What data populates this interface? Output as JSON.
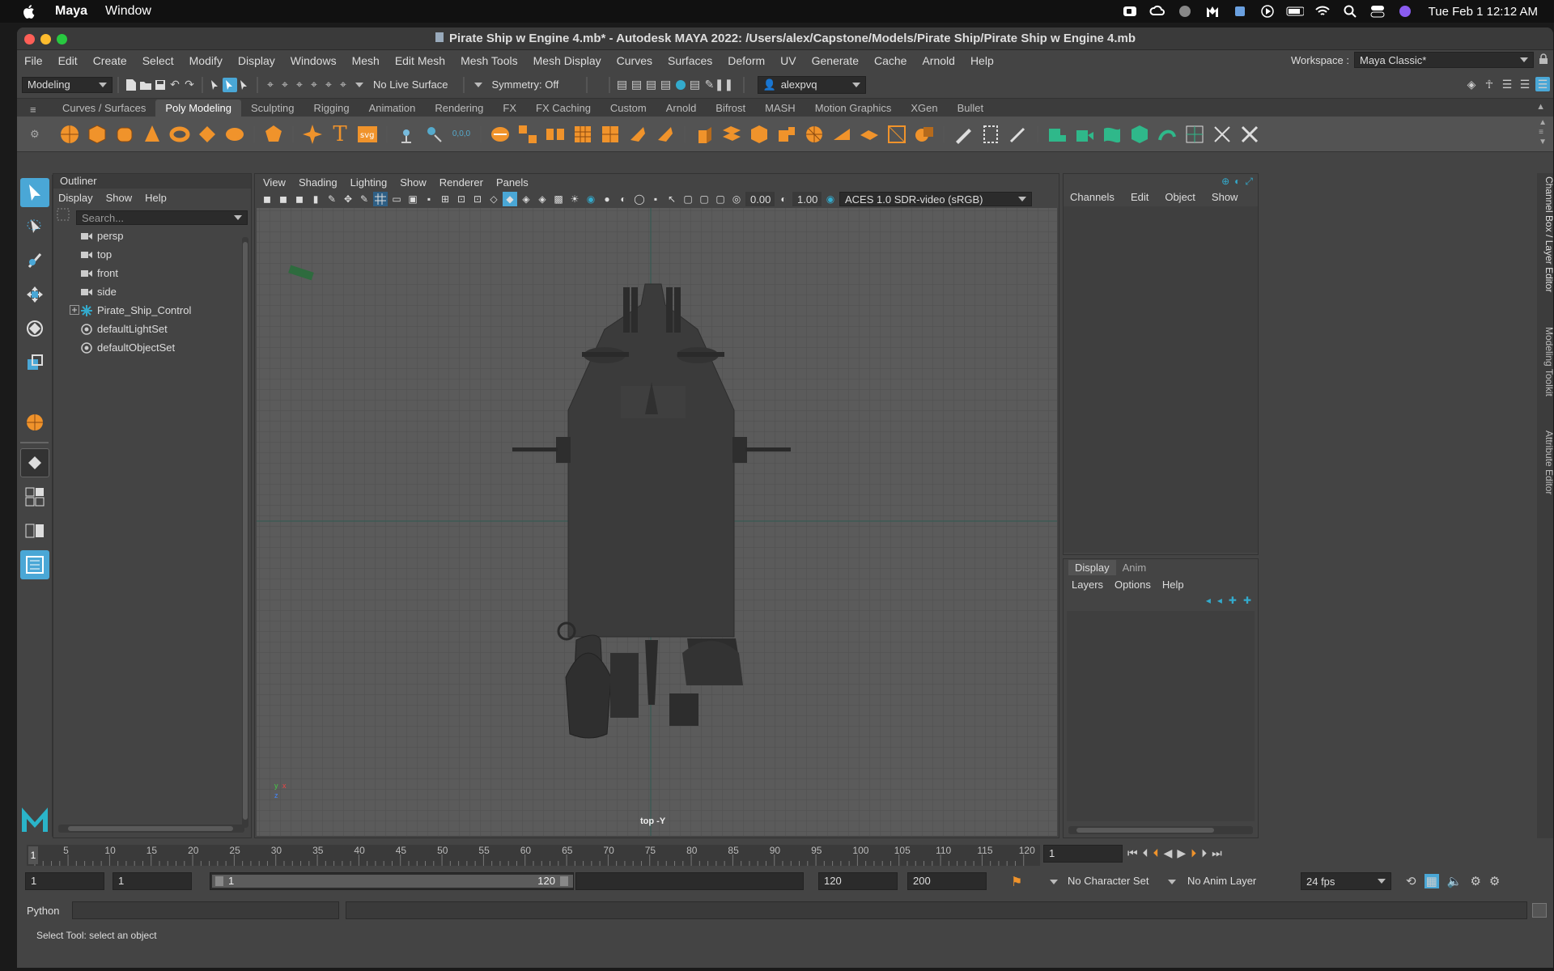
{
  "mac_menubar": {
    "app_name": "Maya",
    "items": [
      "Window"
    ],
    "clock": "Tue Feb 1  12:12 AM"
  },
  "window": {
    "title": "Pirate Ship w Engine 4.mb* - Autodesk MAYA 2022: /Users/alex/Capstone/Models/Pirate Ship/Pirate Ship w Engine 4.mb"
  },
  "menubar": {
    "items": [
      "File",
      "Edit",
      "Create",
      "Select",
      "Modify",
      "Display",
      "Windows",
      "Mesh",
      "Edit Mesh",
      "Mesh Tools",
      "Mesh Display",
      "Curves",
      "Surfaces",
      "Deform",
      "UV",
      "Generate",
      "Cache",
      "Arnold",
      "Help"
    ],
    "workspace_label": "Workspace :",
    "workspace_value": "Maya Classic*"
  },
  "statusline": {
    "mode": "Modeling",
    "live_surface": "No Live Surface",
    "symmetry": "Symmetry: Off",
    "user": "alexpvq"
  },
  "shelf": {
    "tabs": [
      "Curves / Surfaces",
      "Poly Modeling",
      "Sculpting",
      "Rigging",
      "Animation",
      "Rendering",
      "FX",
      "FX Caching",
      "Custom",
      "Arnold",
      "Bifrost",
      "MASH",
      "Motion Graphics",
      "XGen",
      "Bullet"
    ],
    "active_tab": "Poly Modeling"
  },
  "outliner": {
    "title": "Outliner",
    "menu": [
      "Display",
      "Show",
      "Help"
    ],
    "search_placeholder": "Search...",
    "items": [
      {
        "label": "persp",
        "icon": "camera-icon"
      },
      {
        "label": "top",
        "icon": "camera-icon"
      },
      {
        "label": "front",
        "icon": "camera-icon"
      },
      {
        "label": "side",
        "icon": "camera-icon"
      },
      {
        "label": "Pirate_Ship_Control",
        "icon": "locator-icon",
        "expandable": true
      },
      {
        "label": "defaultLightSet",
        "icon": "set-icon"
      },
      {
        "label": "defaultObjectSet",
        "icon": "set-icon"
      }
    ]
  },
  "viewport": {
    "menu": [
      "View",
      "Shading",
      "Lighting",
      "Show",
      "Renderer",
      "Panels"
    ],
    "exposure": "0.00",
    "gamma": "1.00",
    "color_space": "ACES 1.0 SDR-video (sRGB)",
    "camera_label": "top -Y",
    "axis_x": "x",
    "axis_y": "y",
    "axis_z": "z"
  },
  "channel_box": {
    "menu": [
      "Channels",
      "Edit",
      "Object",
      "Show"
    ]
  },
  "layer_editor": {
    "tabs": [
      "Display",
      "Anim"
    ],
    "menu": [
      "Layers",
      "Options",
      "Help"
    ]
  },
  "side_tabs": [
    "Channel Box / Layer Editor",
    "Modeling Toolkit",
    "Attribute Editor"
  ],
  "timeslider": {
    "ticks": [
      "5",
      "10",
      "15",
      "20",
      "25",
      "30",
      "35",
      "40",
      "45",
      "50",
      "55",
      "60",
      "65",
      "70",
      "75",
      "80",
      "85",
      "90",
      "95",
      "100",
      "105",
      "110",
      "115",
      "120"
    ],
    "current_frame_marker": "1",
    "current_frame": "1"
  },
  "range": {
    "start": "1",
    "playback_start": "1",
    "slider_start": "1",
    "slider_end": "120",
    "playback_end": "120",
    "end": "200",
    "character_set": "No Character Set",
    "anim_layer": "No Anim Layer",
    "fps": "24 fps"
  },
  "command_line": {
    "language": "Python"
  },
  "help_line": "Select Tool: select an object",
  "colors": {
    "accent": "#4aa7d6",
    "shelf_orange": "#f0932b",
    "viewport_bg": "#5b5b5b"
  }
}
